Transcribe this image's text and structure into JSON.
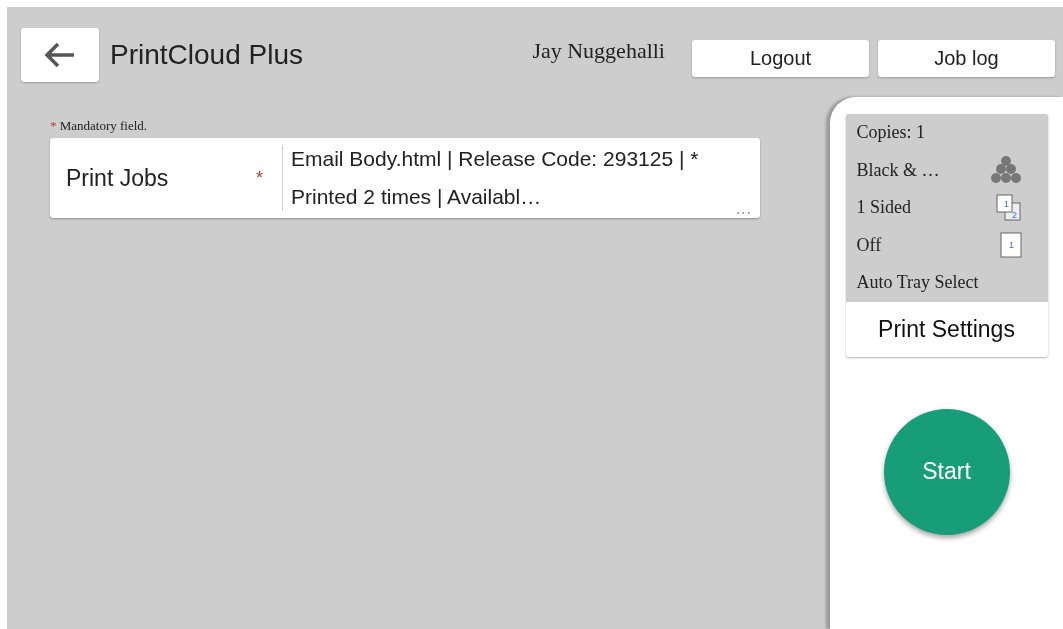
{
  "header": {
    "title": "PrintCloud Plus",
    "user": "Jay Nuggehalli",
    "buttons": [
      "Logout",
      "Job log"
    ]
  },
  "form": {
    "note_mark": "*",
    "note": "Mandatory field.",
    "field": {
      "label": "Print Jobs",
      "required_mark": "*",
      "value": "Email Body.html | Release Code: 293125 | * Printed 2 times | Availabl…",
      "more": "..."
    }
  },
  "settings": {
    "items": [
      {
        "kind": "plain",
        "text": "Copies: 1"
      },
      {
        "kind": "color",
        "text": "Black & …"
      },
      {
        "kind": "duplex",
        "text": "1 Sided",
        "icon_labels": [
          "1",
          "2"
        ]
      },
      {
        "kind": "single",
        "text": "Off",
        "icon_labels": [
          "1"
        ]
      },
      {
        "kind": "plain",
        "text": "Auto Tray Select"
      }
    ],
    "button": "Print Settings"
  },
  "start": "Start"
}
